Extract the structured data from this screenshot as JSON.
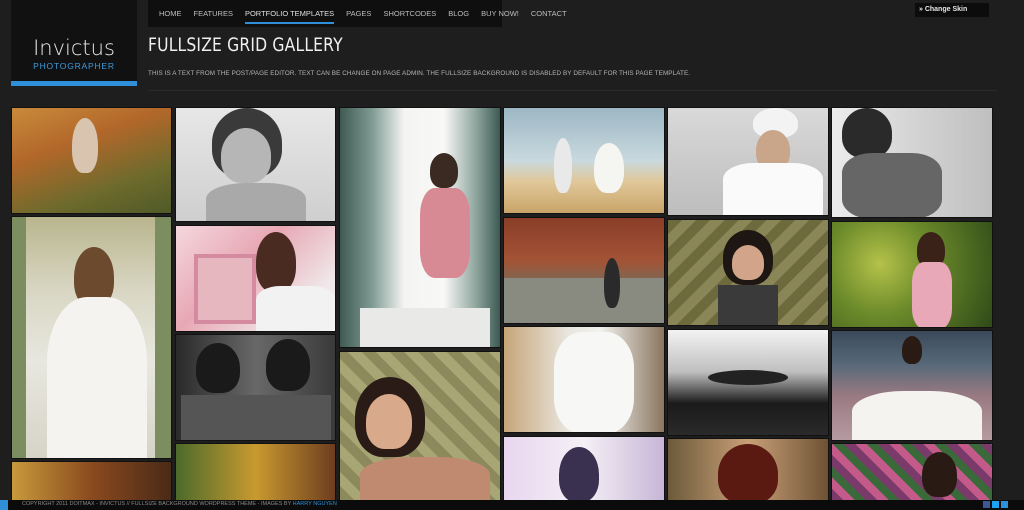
{
  "logo": {
    "name": "Invictus",
    "subtitle": "PHOTOGRAPHER"
  },
  "nav": {
    "items": [
      {
        "label": "HOME"
      },
      {
        "label": "FEATURES"
      },
      {
        "label": "PORTFOLIO TEMPLATES"
      },
      {
        "label": "PAGES"
      },
      {
        "label": "SHORTCODES"
      },
      {
        "label": "BLOG"
      },
      {
        "label": "BUY NOW!"
      },
      {
        "label": "CONTACT"
      }
    ],
    "active_index": 2
  },
  "skin": {
    "label": "» Change Skin"
  },
  "page": {
    "title": "FULLSIZE GRID GALLERY",
    "description": "This is a text from the post/page editor. Text can be change on page admin. The fullsize background is disabled by default for this page template."
  },
  "footer": {
    "copyright": "COPYRIGHT 2011 DOITMAX - INVICTUS // FULLSIZE BACKGROUND WORDPRESS THEME - IMAGES BY",
    "credit": "HARRY NGUYEN"
  },
  "colors": {
    "accent": "#2f8fd8",
    "background": "#1e1e1e"
  }
}
